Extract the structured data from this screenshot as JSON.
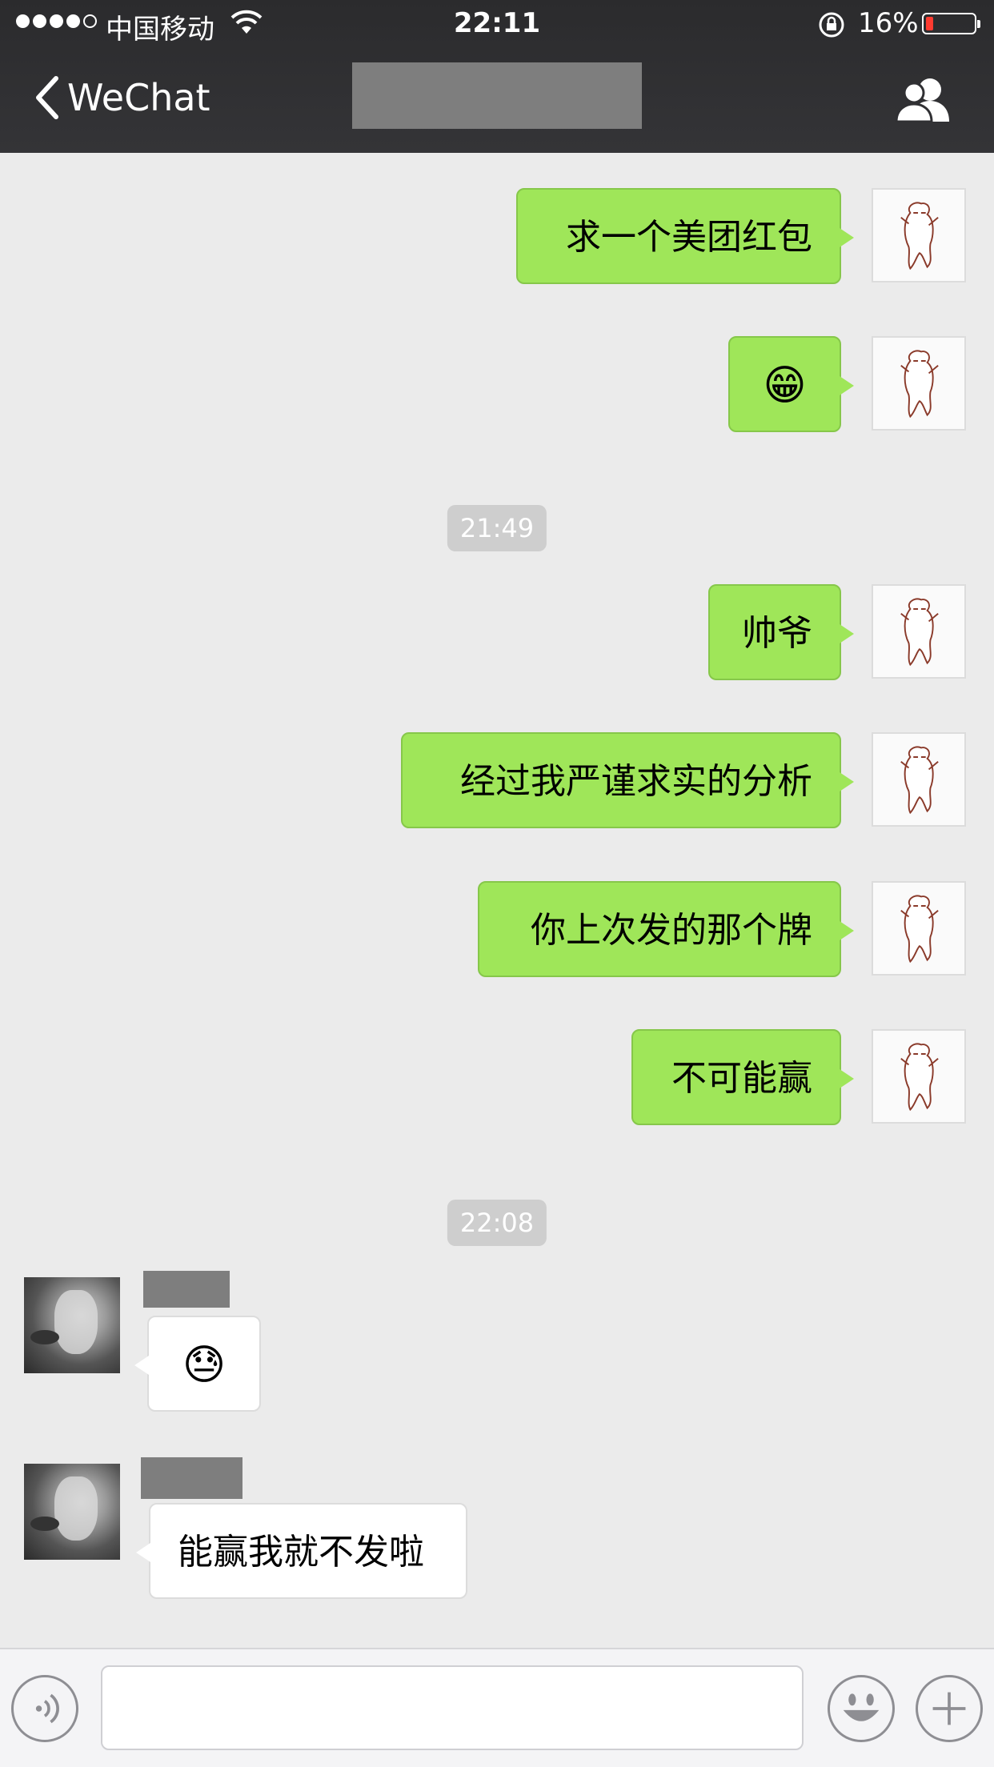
{
  "status_bar": {
    "carrier": "中国移动",
    "time": "22:11",
    "battery_text": "16%",
    "battery_level": 0.16,
    "signal_bars": 4
  },
  "nav": {
    "back_label": "WeChat",
    "title": "",
    "back_icon": "chevron-left-icon",
    "contacts_icon": "contacts-icon"
  },
  "messages": [
    {
      "type": "text",
      "from": "me",
      "text": "求一个美团红包"
    },
    {
      "type": "emoji",
      "from": "me",
      "text": "😁"
    },
    {
      "type": "timestamp",
      "text": "21:49"
    },
    {
      "type": "text",
      "from": "me",
      "text": "帅爷"
    },
    {
      "type": "text",
      "from": "me",
      "text": "经过我严谨求实的分析"
    },
    {
      "type": "text",
      "from": "me",
      "text": "你上次发的那个牌"
    },
    {
      "type": "text",
      "from": "me",
      "text": "不可能赢"
    },
    {
      "type": "timestamp",
      "text": "22:08"
    },
    {
      "type": "emoji",
      "from": "other",
      "text": "😓"
    },
    {
      "type": "text",
      "from": "other",
      "text": "能赢我就不发啦"
    }
  ],
  "input_bar": {
    "voice_icon": "voice-icon",
    "emoji_icon": "smiley-icon",
    "add_icon": "plus-icon",
    "placeholder": ""
  },
  "colors": {
    "nav_bg": "#2f2f31",
    "my_bubble": "#9fe659",
    "other_bubble": "#ffffff",
    "chat_bg": "#ebebeb",
    "redaction": "#7e7e7e"
  }
}
